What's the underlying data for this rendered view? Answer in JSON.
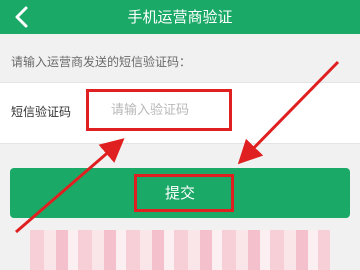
{
  "header": {
    "title": "手机运营商验证",
    "back_icon": "chevron-left-icon"
  },
  "hint": "请输入运营商发送的短信验证码：",
  "form": {
    "label": "短信验证码",
    "code_input": {
      "value": "",
      "placeholder": "请输入验证码"
    }
  },
  "submit": {
    "label": "提交"
  },
  "colors": {
    "accent": "#1aa967",
    "highlight": "#e02020",
    "background": "#f1f1f1"
  }
}
